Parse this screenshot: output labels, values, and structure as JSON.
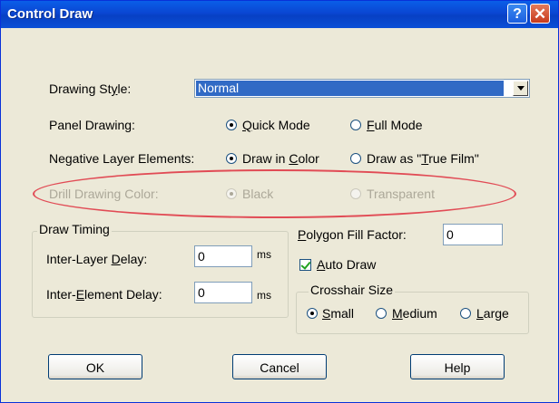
{
  "window": {
    "title": "Control Draw",
    "help_glyph": "?",
    "close_glyph": "✕"
  },
  "drawing_style": {
    "label_pre": "Drawing St",
    "label_u": "y",
    "label_post": "le:",
    "value": "Normal"
  },
  "panel_drawing": {
    "label": "Panel Drawing:",
    "option1": {
      "pre": "",
      "u": "Q",
      "post": "uick Mode",
      "selected": true
    },
    "option2": {
      "pre": "",
      "u": "F",
      "post": "ull Mode",
      "selected": false
    }
  },
  "negative_layer": {
    "label": "Negative Layer Elements:",
    "option1": {
      "pre": "Draw in ",
      "u": "C",
      "post": "olor",
      "selected": true
    },
    "option2": {
      "pre": "Draw as \"",
      "u": "T",
      "post": "rue Film\"",
      "selected": false
    }
  },
  "drill_color": {
    "label": "Drill Drawing Color:",
    "option1": {
      "label": "Black",
      "selected": true
    },
    "option2": {
      "label": "Transparent",
      "selected": false
    }
  },
  "draw_timing": {
    "legend": "Draw Timing",
    "inter_layer": {
      "pre": "Inter-Layer ",
      "u": "D",
      "post": "elay:",
      "value": "0",
      "unit": "ms"
    },
    "inter_element": {
      "pre": "Inter-",
      "u": "E",
      "post": "lement Delay:",
      "value": "0",
      "unit": "ms"
    }
  },
  "polygon_fill": {
    "pre": "",
    "u": "P",
    "post": "olygon Fill Factor:",
    "value": "0"
  },
  "auto_draw": {
    "pre": "",
    "u": "A",
    "post": "uto Draw",
    "checked": true
  },
  "crosshair": {
    "legend": "Crosshair Size",
    "small": {
      "pre": "",
      "u": "S",
      "post": "mall",
      "selected": true
    },
    "medium": {
      "pre": "",
      "u": "M",
      "post": "edium",
      "selected": false
    },
    "large": {
      "pre": "",
      "u": "L",
      "post": "arge",
      "selected": false
    }
  },
  "buttons": {
    "ok": "OK",
    "cancel": "Cancel",
    "help": "Help"
  },
  "colors": {
    "title_bar": "#0a4fd8",
    "dialog_bg": "#ece9d8",
    "selection": "#316ac5",
    "highlight_ellipse": "#e14b55",
    "disabled_text": "#aca899"
  }
}
